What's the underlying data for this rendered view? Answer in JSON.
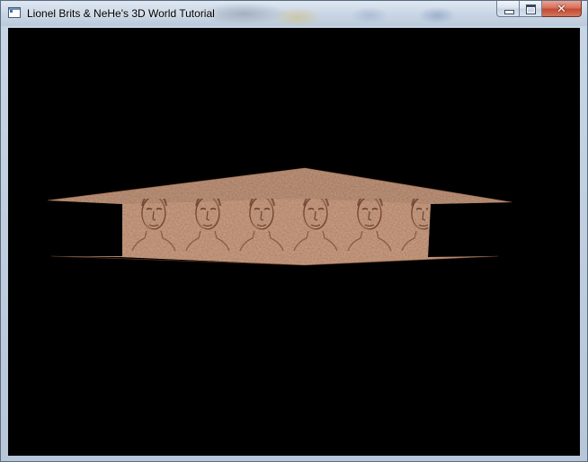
{
  "window": {
    "title": "Lionel Brits & NeHe's 3D World Tutorial",
    "icon": "app-window-icon",
    "caption_buttons": {
      "minimize": "minimize-icon",
      "maximize": "maximize-icon",
      "close": "close-icon"
    }
  },
  "scene": {
    "background_color": "#000000",
    "texture_base_color": "#8b5a40",
    "texture_dark_color": "#5e3423",
    "texture_light_color": "#b47d5f",
    "content": "embossed face texture on ceiling and walls"
  }
}
